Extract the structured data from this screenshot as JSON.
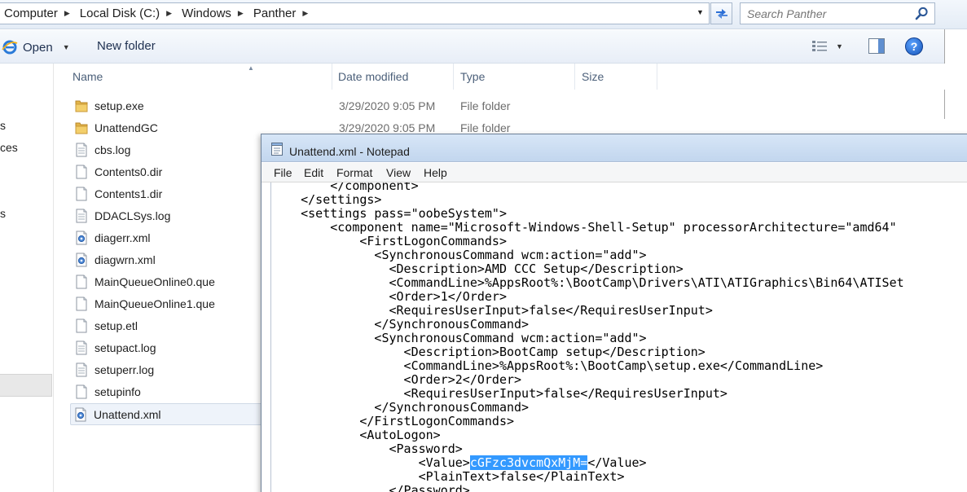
{
  "explorer": {
    "breadcrumb": [
      "Computer",
      "Local Disk (C:)",
      "Windows",
      "Panther"
    ],
    "search": {
      "placeholder": "Search Panther"
    },
    "toolbar": {
      "open_label": "Open",
      "new_folder_label": "New folder"
    },
    "nav_fragments": [
      "s",
      "ces",
      "s"
    ],
    "columns": [
      "Name",
      "Date modified",
      "Type",
      "Size"
    ],
    "files": [
      {
        "name": "setup.exe",
        "date": "3/29/2020 9:05 PM",
        "type": "File folder",
        "icon": "folder-icon"
      },
      {
        "name": "UnattendGC",
        "date": "3/29/2020 9:05 PM",
        "type": "File folder",
        "icon": "folder-icon"
      },
      {
        "name": "cbs.log",
        "date": "",
        "type": "",
        "icon": "text-file-icon"
      },
      {
        "name": "Contents0.dir",
        "date": "",
        "type": "",
        "icon": "file-icon"
      },
      {
        "name": "Contents1.dir",
        "date": "",
        "type": "",
        "icon": "file-icon"
      },
      {
        "name": "DDACLSys.log",
        "date": "",
        "type": "",
        "icon": "text-file-icon"
      },
      {
        "name": "diagerr.xml",
        "date": "",
        "type": "",
        "icon": "xml-file-icon"
      },
      {
        "name": "diagwrn.xml",
        "date": "",
        "type": "",
        "icon": "xml-file-icon"
      },
      {
        "name": "MainQueueOnline0.que",
        "date": "",
        "type": "",
        "icon": "file-icon"
      },
      {
        "name": "MainQueueOnline1.que",
        "date": "",
        "type": "",
        "icon": "file-icon"
      },
      {
        "name": "setup.etl",
        "date": "",
        "type": "",
        "icon": "file-icon"
      },
      {
        "name": "setupact.log",
        "date": "",
        "type": "",
        "icon": "text-file-icon"
      },
      {
        "name": "setuperr.log",
        "date": "",
        "type": "",
        "icon": "text-file-icon"
      },
      {
        "name": "setupinfo",
        "date": "",
        "type": "",
        "icon": "file-icon"
      },
      {
        "name": "Unattend.xml",
        "date": "",
        "type": "",
        "icon": "xml-file-icon",
        "selected": true
      }
    ]
  },
  "notepad": {
    "title": "Unattend.xml - Notepad",
    "menu": [
      "File",
      "Edit",
      "Format",
      "View",
      "Help"
    ],
    "lines": [
      "        </component>",
      "    </settings>",
      "    <settings pass=\"oobeSystem\">",
      "        <component name=\"Microsoft-Windows-Shell-Setup\" processorArchitecture=\"amd64\"",
      "            <FirstLogonCommands>",
      "              <SynchronousCommand wcm:action=\"add\">",
      "                <Description>AMD CCC Setup</Description>",
      "                <CommandLine>%AppsRoot%:\\BootCamp\\Drivers\\ATI\\ATIGraphics\\Bin64\\ATISet",
      "                <Order>1</Order>",
      "                <RequiresUserInput>false</RequiresUserInput>",
      "              </SynchronousCommand>",
      "              <SynchronousCommand wcm:action=\"add\">",
      "                  <Description>BootCamp setup</Description>",
      "                  <CommandLine>%AppsRoot%:\\BootCamp\\setup.exe</CommandLine>",
      "                  <Order>2</Order>",
      "                  <RequiresUserInput>false</RequiresUserInput>",
      "              </SynchronousCommand>",
      "            </FirstLogonCommands>",
      "            <AutoLogon>",
      "                <Password>",
      "                    <Value>",
      "                    <PlainText>false</PlainText>",
      "                </Password>"
    ],
    "password_line": {
      "before": "                    <Value>",
      "selected": "cGFzc3dvcmQxMjM=",
      "after": "</Value>"
    }
  }
}
